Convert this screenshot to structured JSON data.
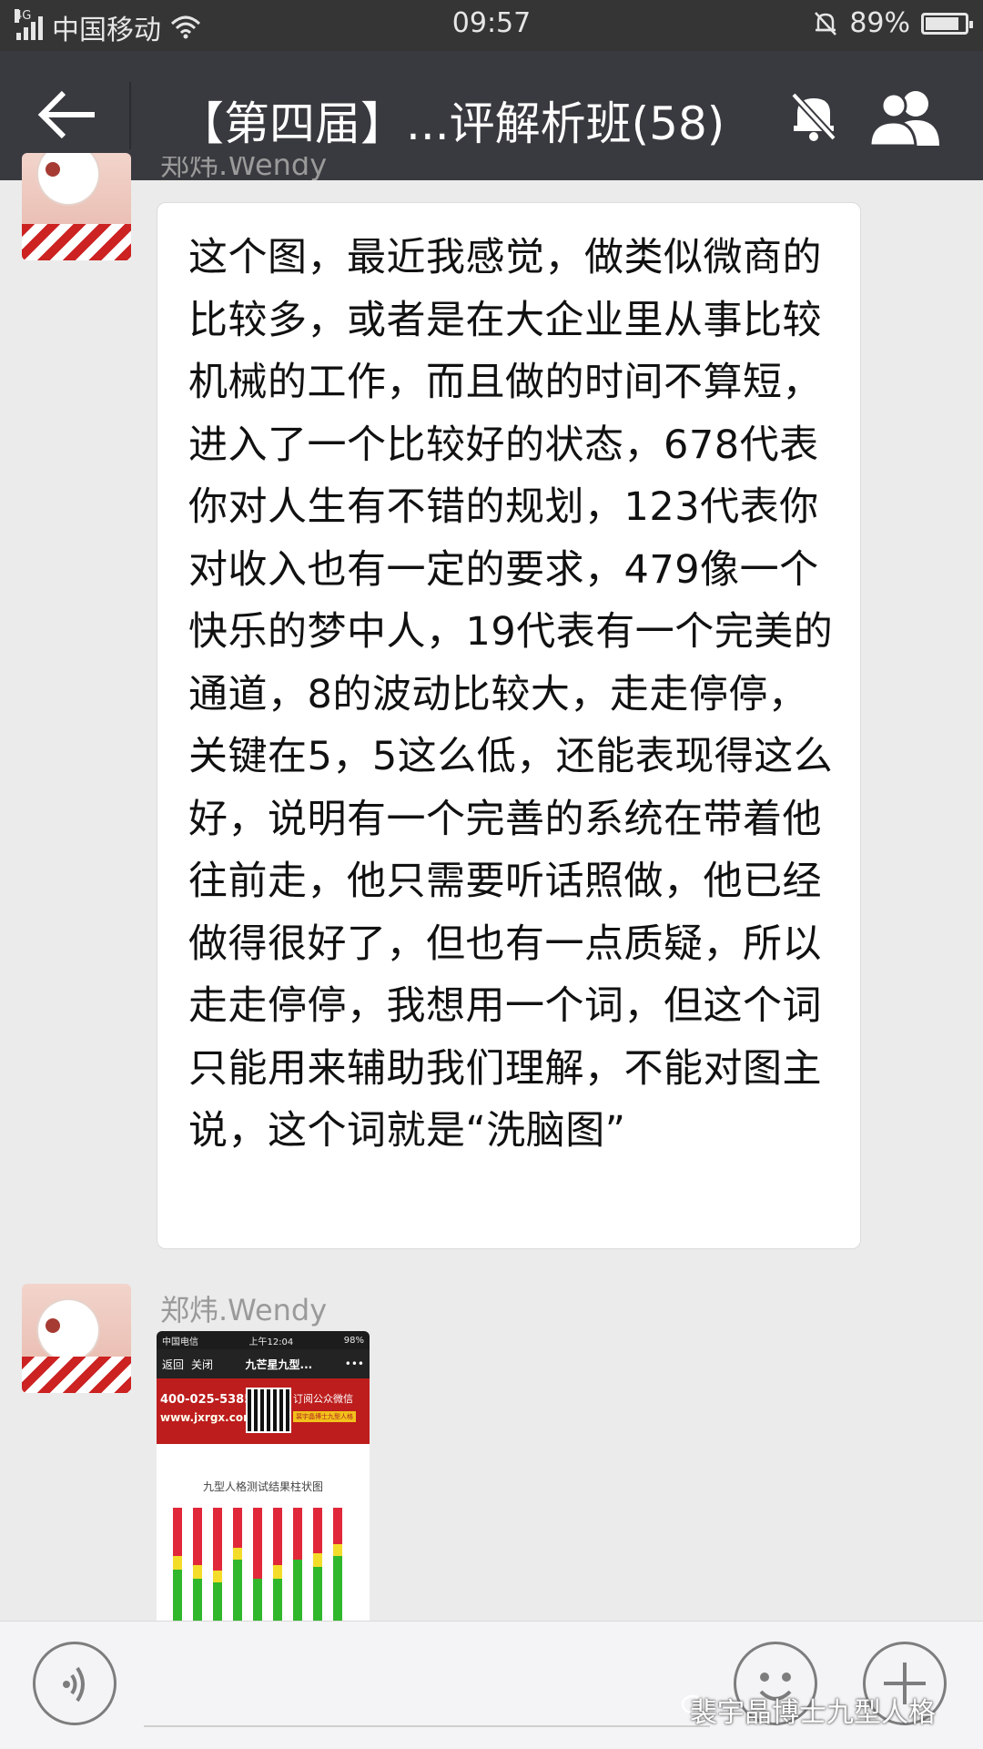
{
  "status_bar": {
    "network": "4G",
    "carrier": "中国移动",
    "time": "09:57",
    "battery_percent": "89%",
    "battery_level": 0.89
  },
  "header": {
    "title": "【第四届】...评解析班(58)",
    "back_icon": "back-arrow-icon",
    "mute_icon": "mute-icon",
    "members_icon": "group-members-icon"
  },
  "messages": [
    {
      "sender": "郑炜.Wendy",
      "type": "text",
      "text": "这个图，最近我感觉，做类似微商的比较多，或者是在大企业里从事比较机械的工作，而且做的时间不算短，进入了一个比较好的状态，678代表你对人生有不错的规划，123代表你对收入也有一定的要求，479像一个快乐的梦中人，19代表有一个完美的通道，8的波动比较大，走走停停，关键在5，5这么低，还能表现得这么好，说明有一个完善的系统在带着他往前走，他只需要听话照做，他已经做得很好了，但也有一点质疑，所以走走停停，我想用一个词，但这个词只能用来辅助我们理解，不能对图主说，这个词就是“洗脑图”"
    },
    {
      "sender": "郑炜.Wendy",
      "type": "image",
      "image": {
        "status_carrier": "中国电信",
        "status_time": "上午12:04",
        "status_battery": "98%",
        "nav_back": "返回",
        "nav_close": "关闭",
        "nav_title": "九芒星九型...",
        "nav_more": "•••",
        "phone": "400-025-5385",
        "url": "www.jxrgx.com",
        "subscribe": "订阅公众微信",
        "badge": "裴宇晶博士九型人格",
        "chart_title": "九型人格测试结果柱状图",
        "bars": [
          {
            "red": 0.42,
            "yellow": 0.12,
            "green": 0.46
          },
          {
            "red": 0.5,
            "yellow": 0.12,
            "green": 0.38
          },
          {
            "red": 0.55,
            "yellow": 0.1,
            "green": 0.35
          },
          {
            "red": 0.35,
            "yellow": 0.1,
            "green": 0.55
          },
          {
            "red": 0.62,
            "yellow": 0.0,
            "green": 0.38
          },
          {
            "red": 0.5,
            "yellow": 0.12,
            "green": 0.38
          },
          {
            "red": 0.45,
            "yellow": 0.0,
            "green": 0.55
          },
          {
            "red": 0.4,
            "yellow": 0.12,
            "green": 0.48
          },
          {
            "red": 0.32,
            "yellow": 0.1,
            "green": 0.58
          }
        ]
      }
    }
  ],
  "input_bar": {
    "voice_icon": "voice-icon",
    "emoji_icon": "emoji-icon",
    "plus_icon": "plus-icon"
  },
  "watermark": {
    "text": "裴宇晶博士九型人格",
    "icon": "wechat-icon"
  },
  "colors": {
    "header_bg": "#393a3f",
    "chat_bg": "#ebebeb",
    "bar_red": "#e0283a",
    "bar_yellow": "#f4dc2a",
    "bar_green": "#31b72c"
  }
}
